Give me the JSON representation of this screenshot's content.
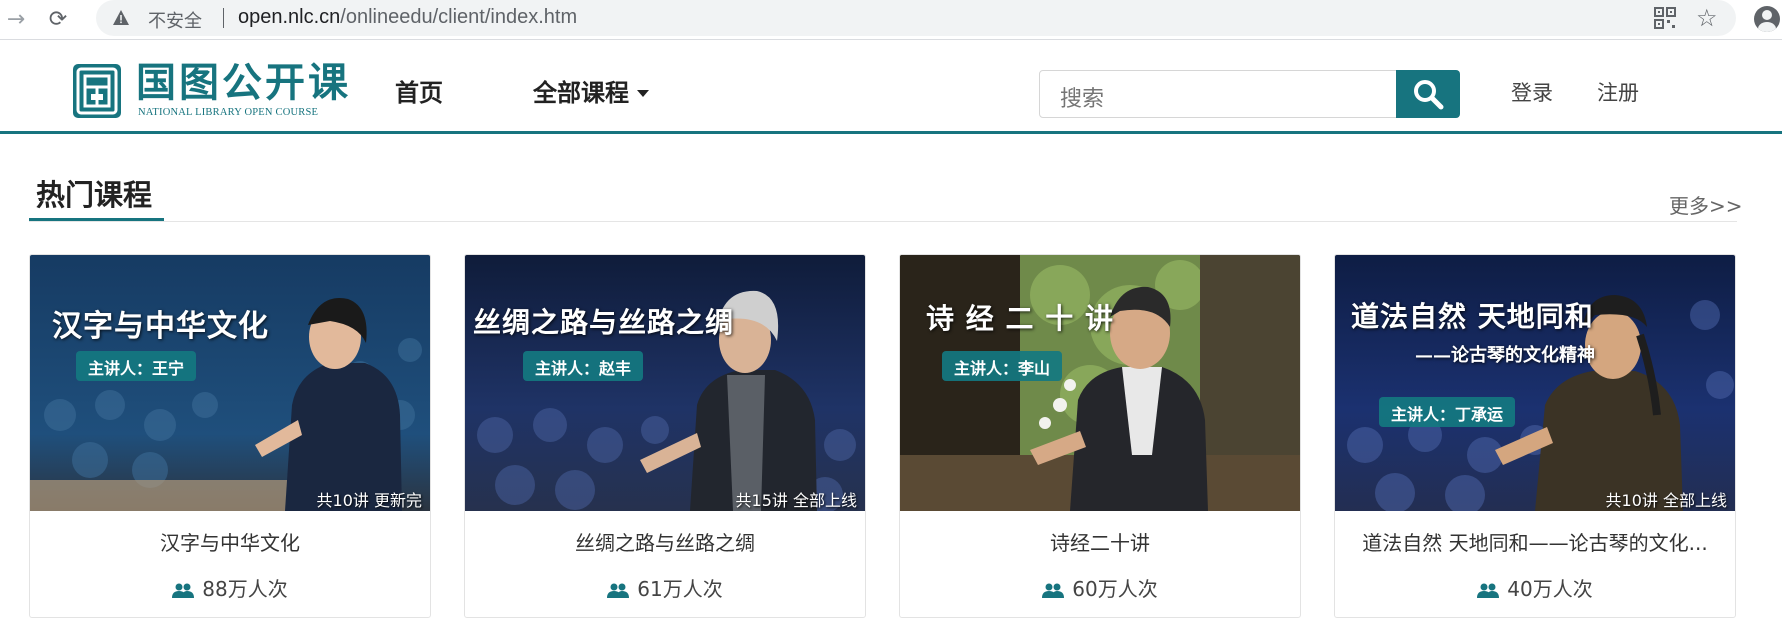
{
  "browser": {
    "insecure_label": "不安全",
    "url_host": "open.nlc.cn",
    "url_path": "/onlineedu/client/index.htm"
  },
  "header": {
    "logo_cn": "国图公开课",
    "logo_en": "NATIONAL LIBRARY OPEN COURSE",
    "nav": {
      "home": "首页",
      "all_courses": "全部课程"
    },
    "search": {
      "placeholder": "搜索"
    },
    "login": "登录",
    "register": "注册",
    "accent_color": "#17747f"
  },
  "section": {
    "title": "热门课程",
    "more": "更多>>"
  },
  "courses": [
    {
      "thumb_title": "汉字与中华文化",
      "lecturer": "主讲人：王宁",
      "episodes": "共10讲  更新完",
      "title": "汉字与中华文化",
      "views": "88万人次"
    },
    {
      "thumb_title": "丝绸之路与丝路之绸",
      "lecturer": "主讲人：赵丰",
      "episodes": "共15讲  全部上线",
      "title": "丝绸之路与丝路之绸",
      "views": "61万人次"
    },
    {
      "thumb_title": "诗 经 二 十 讲",
      "lecturer": "主讲人：李山",
      "episodes": "",
      "title": "诗经二十讲",
      "views": "60万人次"
    },
    {
      "thumb_title": "道法自然 天地同和",
      "thumb_subtitle": "——论古琴的文化精神",
      "lecturer": "主讲人：丁承运",
      "episodes": "共10讲  全部上线",
      "title": "道法自然 天地同和——论古琴的文化...",
      "views": "40万人次"
    }
  ]
}
